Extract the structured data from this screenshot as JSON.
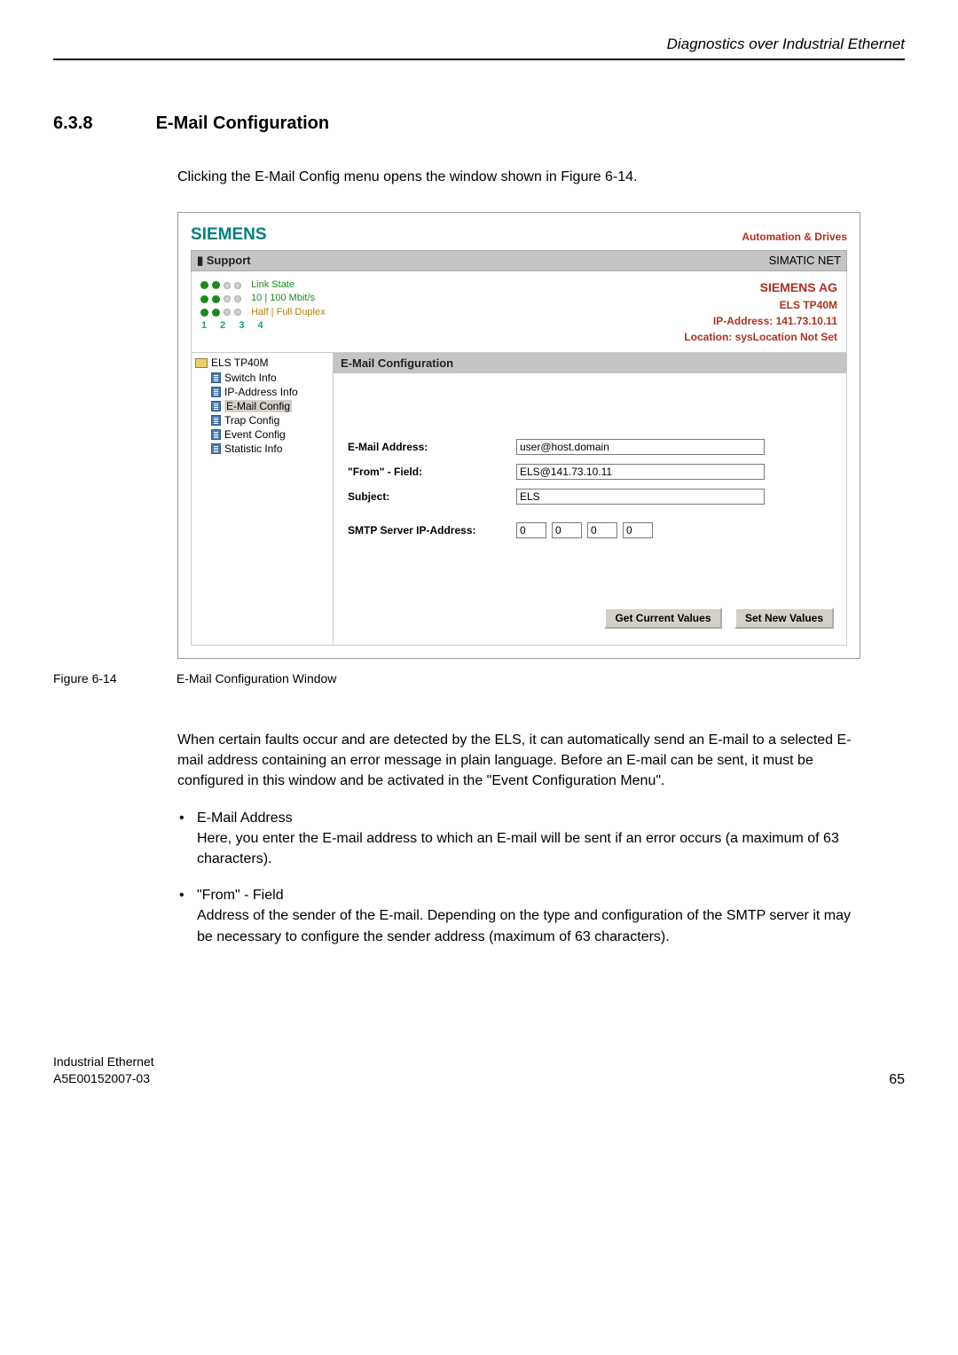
{
  "page_header": "Diagnostics over Industrial Ethernet",
  "section": {
    "number": "6.3.8",
    "title": "E-Mail Configuration"
  },
  "intro": "Clicking the E-Mail Config menu opens the window shown in Figure 6-14.",
  "screenshot": {
    "brand": "SIEMENS",
    "top_link": "Automation & Drives",
    "support_bar_left": "▮ Support",
    "support_bar_right": "SIMATIC NET",
    "leds": {
      "row1": "Link State",
      "row2": "10 | 100 Mbit/s",
      "row3": "Half | Full Duplex",
      "nums": "1 2 3 4"
    },
    "info": {
      "line1": "SIEMENS AG",
      "line2": "ELS TP40M",
      "line3": "IP-Address:  141.73.10.11",
      "line4": "Location:  sysLocation Not Set"
    },
    "tree": {
      "root": "ELS TP40M",
      "items": [
        "Switch Info",
        "IP-Address Info",
        "E-Mail Config",
        "Trap Config",
        "Event Config",
        "Statistic Info"
      ],
      "selected_index": 2
    },
    "content_header": "E-Mail Configuration",
    "form": {
      "email_label": "E-Mail Address:",
      "email_value": "user@host.domain",
      "from_label": "\"From\" - Field:",
      "from_value": "ELS@141.73.10.11",
      "subject_label": "Subject:",
      "subject_value": "ELS",
      "smtp_label": "SMTP Server IP-Address:",
      "smtp": [
        "0",
        "0",
        "0",
        "0"
      ]
    },
    "buttons": {
      "get": "Get Current Values",
      "set": "Set New Values"
    }
  },
  "figure": {
    "num": "Figure 6-14",
    "caption": "E-Mail Configuration Window"
  },
  "body": {
    "para1": "When certain faults occur and are detected by the ELS, it can automatically send an E-mail to a selected E-mail address containing an error message in plain language. Before an E-mail can be sent, it must be configured in this window and be activated in the \"Event Configuration Menu\".",
    "b1_head": "E-Mail Address",
    "b1_text": "Here, you enter the E-mail address to which an E-mail will be sent if an error occurs (a maximum of 63 characters).",
    "b2_head": "\"From\" - Field",
    "b2_text": "Address of the sender of the E-mail. Depending on the type and configuration of the SMTP server it may be necessary to configure the sender address (maximum of 63 characters)."
  },
  "footer": {
    "left1": "Industrial Ethernet",
    "left2": "A5E00152007-03",
    "page": "65"
  }
}
